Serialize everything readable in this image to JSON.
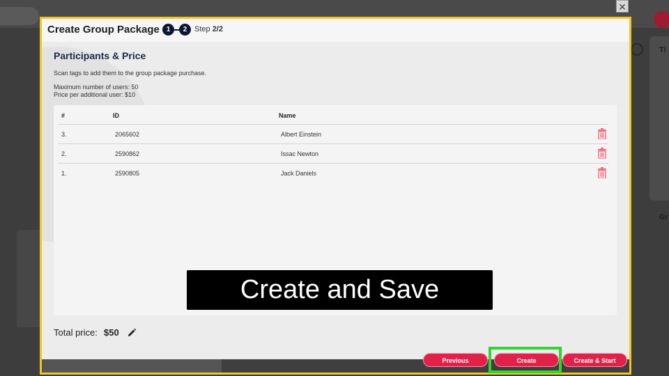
{
  "modal": {
    "title": "Create Group Package",
    "step1": "1",
    "step2": "2",
    "step_prefix": "Step ",
    "step_value": "2/2",
    "close_glyph": "✕"
  },
  "section": {
    "title": "Participants & Price",
    "hint": "Scan tags to add them to the group package purchase.",
    "max_users": "Maximum number of users: 50",
    "price_per_user": "Price per additional user: $10"
  },
  "table": {
    "headers": [
      "#",
      "ID",
      "Name"
    ],
    "rows": [
      {
        "num": "3.",
        "id": "2065602",
        "name": "Albert Einstein"
      },
      {
        "num": "2.",
        "id": "2590862",
        "name": "Issac Newton"
      },
      {
        "num": "1.",
        "id": "2590805",
        "name": "Jack Daniels"
      }
    ]
  },
  "total": {
    "label": "Total price:",
    "value": "$50"
  },
  "buttons": {
    "previous": "Previous",
    "create": "Create",
    "create_start": "Create & Start"
  },
  "caption": "Create and Save",
  "background": {
    "right_text1": "Ti",
    "right_text2": "Gr"
  },
  "colors": {
    "accent": "#e0224a",
    "modal_border": "#f2c522",
    "highlight": "#2ed62e",
    "step_dot": "#0e1633"
  }
}
